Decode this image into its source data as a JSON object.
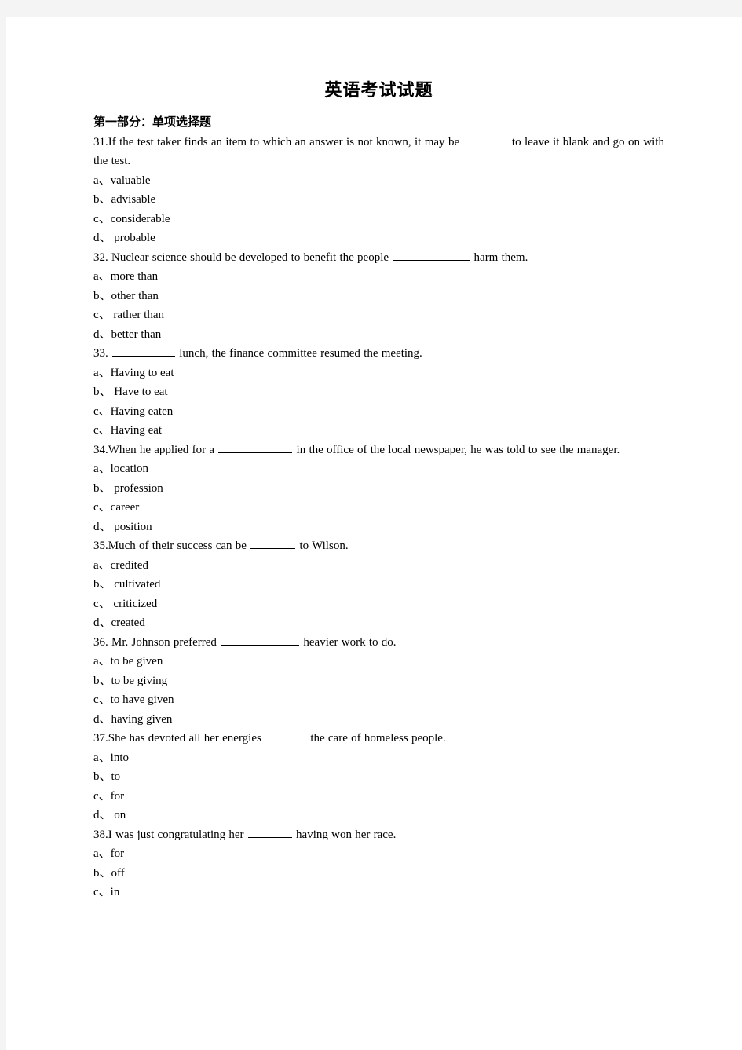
{
  "document": {
    "title": "英语考试试题",
    "section_heading": "第一部分：单项选择题"
  },
  "questions": [
    {
      "number": "31.",
      "stem_before": "31.If the test taker finds an item to which an answer is not known, it may be",
      "stem_after": "to leave it blank and go on with the test.",
      "blank_width": 56,
      "options": [
        {
          "marker": "a、",
          "text": "valuable"
        },
        {
          "marker": "b、",
          "text": "advisable"
        },
        {
          "marker": "c、",
          "text": "considerable"
        },
        {
          "marker": "d、",
          "text": " probable"
        }
      ]
    },
    {
      "number": "32.",
      "stem_before": "32. Nuclear science should be developed to benefit the people",
      "stem_after": "harm them.",
      "blank_width": 98,
      "options": [
        {
          "marker": "a、",
          "text": "more than"
        },
        {
          "marker": "b、",
          "text": "other than"
        },
        {
          "marker": "c、",
          "text": " rather than"
        },
        {
          "marker": "d、",
          "text": "better than"
        }
      ]
    },
    {
      "number": "33.",
      "stem_before": "33.",
      "stem_after": "lunch, the finance committee resumed the meeting.",
      "blank_width": 80,
      "options": [
        {
          "marker": "a、",
          "text": "Having to eat"
        },
        {
          "marker": "b、",
          "text": " Have to eat"
        },
        {
          "marker": "c、",
          "text": "Having eaten"
        },
        {
          "marker": "c、",
          "text": "Having eat"
        }
      ]
    },
    {
      "number": "34.",
      "stem_before": "34.When he applied for a",
      "stem_after": "in the office of the local newspaper, he was told to see the manager.",
      "blank_width": 94,
      "options": [
        {
          "marker": "a、",
          "text": "location"
        },
        {
          "marker": "b、",
          "text": " profession"
        },
        {
          "marker": "c、",
          "text": "career"
        },
        {
          "marker": "d、",
          "text": " position"
        }
      ]
    },
    {
      "number": "35.",
      "stem_before": "35.Much of their success can be",
      "stem_after": "to Wilson.",
      "blank_width": 57,
      "options": [
        {
          "marker": "a、",
          "text": "credited"
        },
        {
          "marker": "b、",
          "text": " cultivated"
        },
        {
          "marker": "c、",
          "text": " criticized"
        },
        {
          "marker": "d、",
          "text": "created"
        }
      ]
    },
    {
      "number": "36.",
      "stem_before": "36. Mr. Johnson preferred",
      "stem_after": "heavier work to do.",
      "blank_width": 100,
      "options": [
        {
          "marker": "a、",
          "text": "to be given"
        },
        {
          "marker": "b、",
          "text": "to be giving"
        },
        {
          "marker": "c、",
          "text": "to have given"
        },
        {
          "marker": "d、",
          "text": "having given"
        }
      ]
    },
    {
      "number": "37.",
      "stem_before": "37.She has devoted all her energies",
      "stem_after": "the care of homeless people.",
      "blank_width": 52,
      "options": [
        {
          "marker": "a、",
          "text": "into"
        },
        {
          "marker": "b、",
          "text": "to"
        },
        {
          "marker": "c、",
          "text": "for"
        },
        {
          "marker": "d、",
          "text": " on"
        }
      ]
    },
    {
      "number": "38.",
      "stem_before": "38.I was just congratulating her",
      "stem_after": "having won her race.",
      "blank_width": 56,
      "options": [
        {
          "marker": "a、",
          "text": "for"
        },
        {
          "marker": "b、",
          "text": "off"
        },
        {
          "marker": "c、",
          "text": "in"
        }
      ]
    }
  ]
}
